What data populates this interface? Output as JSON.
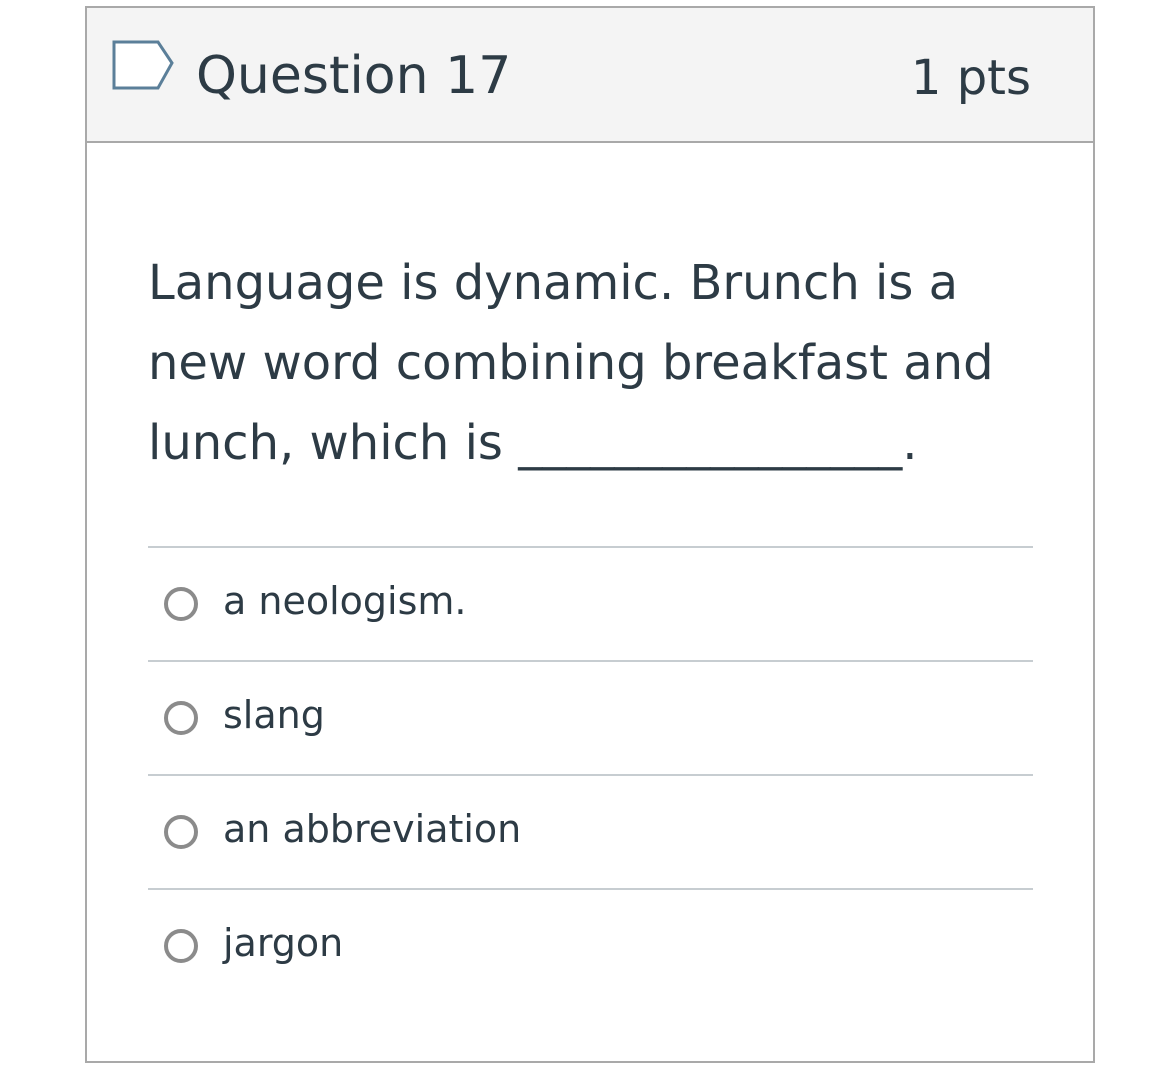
{
  "question": {
    "title": "Question 17",
    "points": "1 pts",
    "flag_icon": "flag-outline-icon",
    "text": "Language is dynamic.  Brunch is a new word combining breakfast and lunch, which is ________________."
  },
  "answers": [
    {
      "label": "a neologism.",
      "selected": false
    },
    {
      "label": "slang",
      "selected": false
    },
    {
      "label": "an abbreviation",
      "selected": false
    },
    {
      "label": "jargon",
      "selected": false
    }
  ],
  "colors": {
    "text": "#2d3b45",
    "header_bg": "#f4f4f4",
    "border": "#a9a9a9",
    "divider": "#c7cdd1",
    "flag": "#5b7f99",
    "radio": "#8b8b8b"
  }
}
